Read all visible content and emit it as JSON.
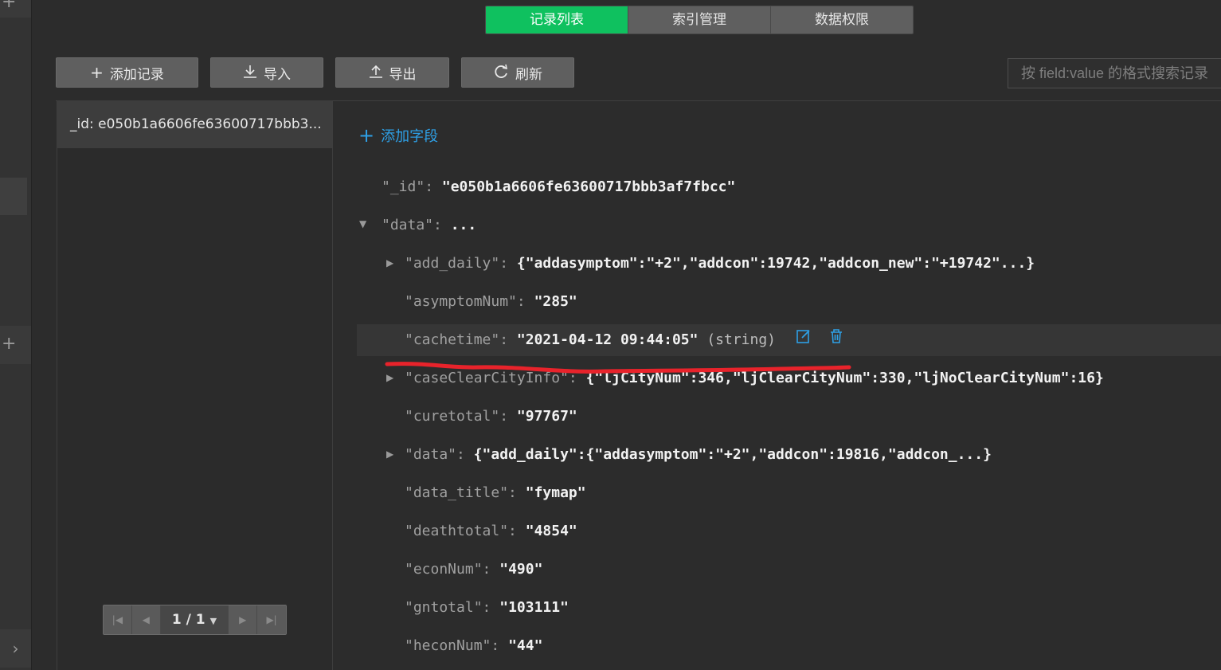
{
  "tabs": [
    {
      "label": "记录列表",
      "active": true
    },
    {
      "label": "索引管理",
      "active": false
    },
    {
      "label": "数据权限",
      "active": false
    }
  ],
  "toolbar": {
    "add_record": "添加记录",
    "import": "导入",
    "export": "导出",
    "refresh": "刷新"
  },
  "search": {
    "placeholder": "按 field:value 的格式搜索记录"
  },
  "records": [
    {
      "label": "_id: e050b1a6606fe63600717bbb3..."
    }
  ],
  "pager": {
    "label": "1 / 1"
  },
  "document": {
    "add_field": "添加字段",
    "id_key": "\"_id\"",
    "id_value": "\"e050b1a6606fe63600717bbb3af7fbcc\"",
    "data_key": "\"data\"",
    "data_value": "...",
    "fields": [
      {
        "key": "\"add_daily\"",
        "value": "{\"addasymptom\":\"+2\",\"addcon\":19742,\"addcon_new\":\"+19742\"...}"
      },
      {
        "key": "\"asymptomNum\"",
        "value": "\"285\""
      },
      {
        "key": "\"cachetime\"",
        "value": "\"2021-04-12 09:44:05\"",
        "type": "(string)"
      },
      {
        "key": "\"caseClearCityInfo\"",
        "value": "{\"ljCityNum\":346,\"ljClearCityNum\":330,\"ljNoClearCityNum\":16}"
      },
      {
        "key": "\"curetotal\"",
        "value": "\"97767\""
      },
      {
        "key": "\"data\"",
        "value": "{\"add_daily\":{\"addasymptom\":\"+2\",\"addcon\":19816,\"addcon_...}"
      },
      {
        "key": "\"data_title\"",
        "value": "\"fymap\""
      },
      {
        "key": "\"deathtotal\"",
        "value": "\"4854\""
      },
      {
        "key": "\"econNum\"",
        "value": "\"490\""
      },
      {
        "key": "\"gntotal\"",
        "value": "\"103111\""
      },
      {
        "key": "\"heconNum\"",
        "value": "\"44\""
      }
    ]
  },
  "colors": {
    "accent": "#0fc15f",
    "link": "#2ea0e6",
    "annotation": "#e8232b"
  }
}
